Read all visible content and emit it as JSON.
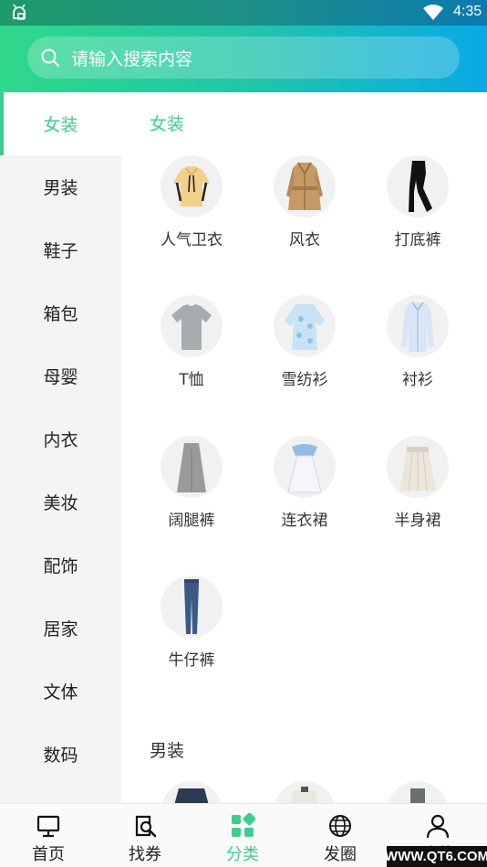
{
  "status_bar": {
    "time": "4:35",
    "left_icon": "android-notification-icon",
    "wifi_icon": "wifi-icon",
    "battery_icon": "battery-icon"
  },
  "search": {
    "placeholder": "请输入搜索内容",
    "icon": "search-icon"
  },
  "sidebar": {
    "items": [
      {
        "label": "女装",
        "active": true
      },
      {
        "label": "男装"
      },
      {
        "label": "鞋子"
      },
      {
        "label": "箱包"
      },
      {
        "label": "母婴"
      },
      {
        "label": "内衣"
      },
      {
        "label": "美妆"
      },
      {
        "label": "配饰"
      },
      {
        "label": "居家"
      },
      {
        "label": "文体"
      },
      {
        "label": "数码"
      }
    ]
  },
  "content": {
    "sections": [
      {
        "title": "女装",
        "items": [
          {
            "label": "人气卫衣",
            "icon": "hoodie-icon"
          },
          {
            "label": "风衣",
            "icon": "trench-coat-icon"
          },
          {
            "label": "打底裤",
            "icon": "leggings-icon"
          },
          {
            "label": "T恤",
            "icon": "tshirt-icon"
          },
          {
            "label": "雪纺衫",
            "icon": "chiffon-blouse-icon"
          },
          {
            "label": "衬衫",
            "icon": "shirt-icon"
          },
          {
            "label": "阔腿裤",
            "icon": "wide-leg-pants-icon"
          },
          {
            "label": "连衣裙",
            "icon": "dress-icon"
          },
          {
            "label": "半身裙",
            "icon": "skirt-icon"
          },
          {
            "label": "牛仔裤",
            "icon": "jeans-icon"
          }
        ]
      },
      {
        "title": "男装"
      }
    ]
  },
  "bottom_nav": {
    "items": [
      {
        "label": "首页",
        "icon": "monitor-icon"
      },
      {
        "label": "找券",
        "icon": "coupon-search-icon"
      },
      {
        "label": "分类",
        "icon": "category-grid-icon",
        "active": true
      },
      {
        "label": "发圈",
        "icon": "globe-icon"
      },
      {
        "label": "我的",
        "icon": "user-icon"
      }
    ]
  },
  "watermark": "WWW.QT6.COM",
  "colors": {
    "accent": "#3bcf8e",
    "gradient_start": "#2fd88a",
    "gradient_end": "#0aa9e6"
  }
}
